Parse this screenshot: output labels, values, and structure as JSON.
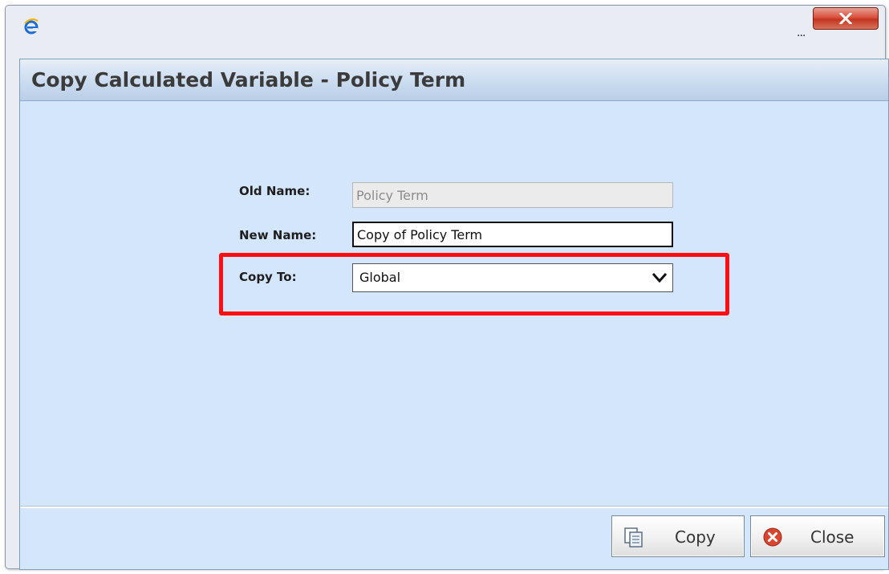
{
  "window": {
    "ellipsis": "..."
  },
  "dialog": {
    "title": "Copy Calculated Variable - Policy Term"
  },
  "form": {
    "old_name": {
      "label": "Old Name:",
      "value": "Policy Term"
    },
    "new_name": {
      "label": "New Name:",
      "value": "Copy of Policy Term"
    },
    "copy_to": {
      "label": "Copy To:",
      "selected": "Global"
    }
  },
  "buttons": {
    "copy_label": "Copy",
    "close_label": "Close"
  },
  "colors": {
    "highlight": "#ff0f14",
    "dialog_background": "#d4e6fb",
    "window_close": "#c33421"
  },
  "icons": {
    "app": "internet-explorer-icon",
    "window_close": "close-x-icon",
    "dropdown": "chevron-down-icon",
    "copy": "copy-document-icon",
    "close": "close-circle-icon"
  }
}
